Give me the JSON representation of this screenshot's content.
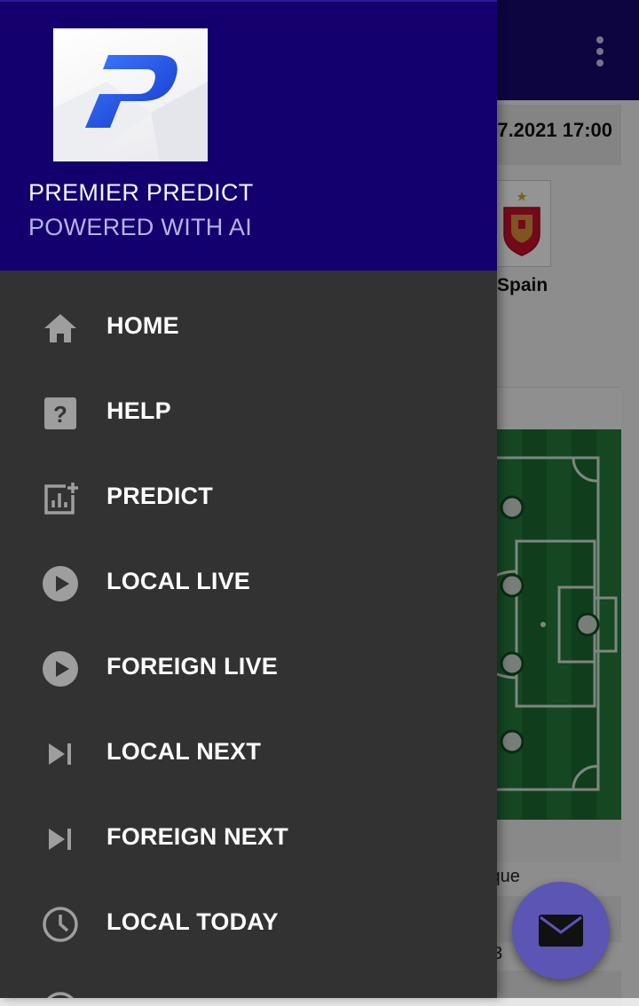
{
  "drawer": {
    "app_name": "PREMIER PREDICT",
    "tagline": "POWERED WITH AI",
    "logo": "premier-predict-logo",
    "items": [
      {
        "label": "HOME",
        "icon": "home-icon"
      },
      {
        "label": "HELP",
        "icon": "help-icon"
      },
      {
        "label": "PREDICT",
        "icon": "add-chart-icon"
      },
      {
        "label": "LOCAL LIVE",
        "icon": "play-circle-icon"
      },
      {
        "label": "FOREIGN LIVE",
        "icon": "play-circle-icon"
      },
      {
        "label": "LOCAL NEXT",
        "icon": "skip-next-icon"
      },
      {
        "label": "FOREIGN NEXT",
        "icon": "skip-next-icon"
      },
      {
        "label": "LOCAL TODAY",
        "icon": "clock-icon"
      },
      {
        "label": "",
        "icon": "clock-icon"
      }
    ]
  },
  "background": {
    "match_datetime_partial": "7.2021 17:00",
    "team_name": "Spain",
    "pitch_caption_partial": "ique",
    "row_text_partial": "3"
  },
  "fab": {
    "icon": "mail-icon"
  },
  "colors": {
    "header": "#13006e",
    "drawer": "#323232",
    "toolbar": "#160a6e",
    "fab": "#5b55b4",
    "tagline": "#b8b2e6"
  }
}
